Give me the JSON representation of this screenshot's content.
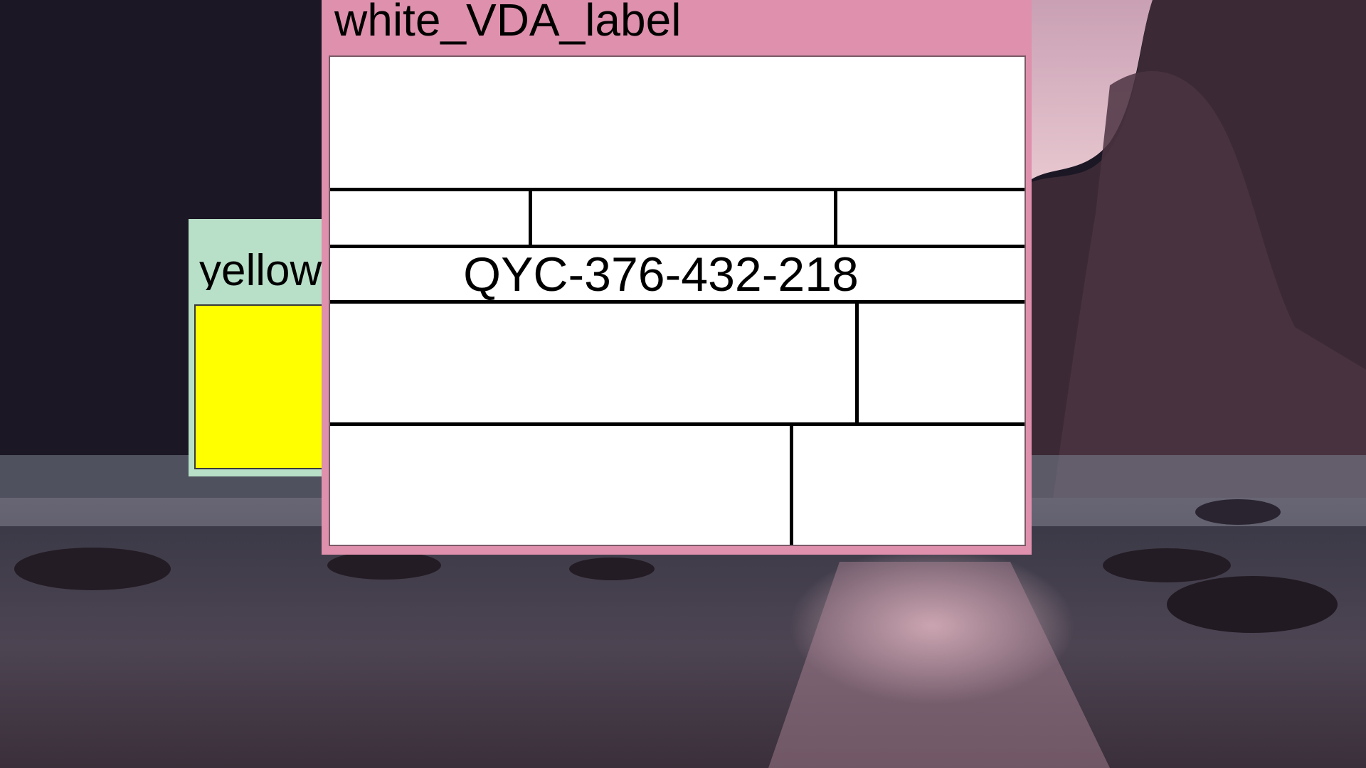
{
  "desktop": {
    "wallpaper": "night-beach-cliffs",
    "colors": {
      "sky": "#2a2233",
      "water_glow": "#d9a8b8"
    }
  },
  "windows": [
    {
      "id": "yellow",
      "title": "yellow",
      "title_bar_color": "#b8e0c8",
      "content_color": "#ffff00"
    },
    {
      "id": "white",
      "title": "white_VDA_label",
      "title_bar_color": "#de90ac",
      "content_color": "#ffffff",
      "label": {
        "code": "QYC-376-432-218"
      }
    }
  ]
}
